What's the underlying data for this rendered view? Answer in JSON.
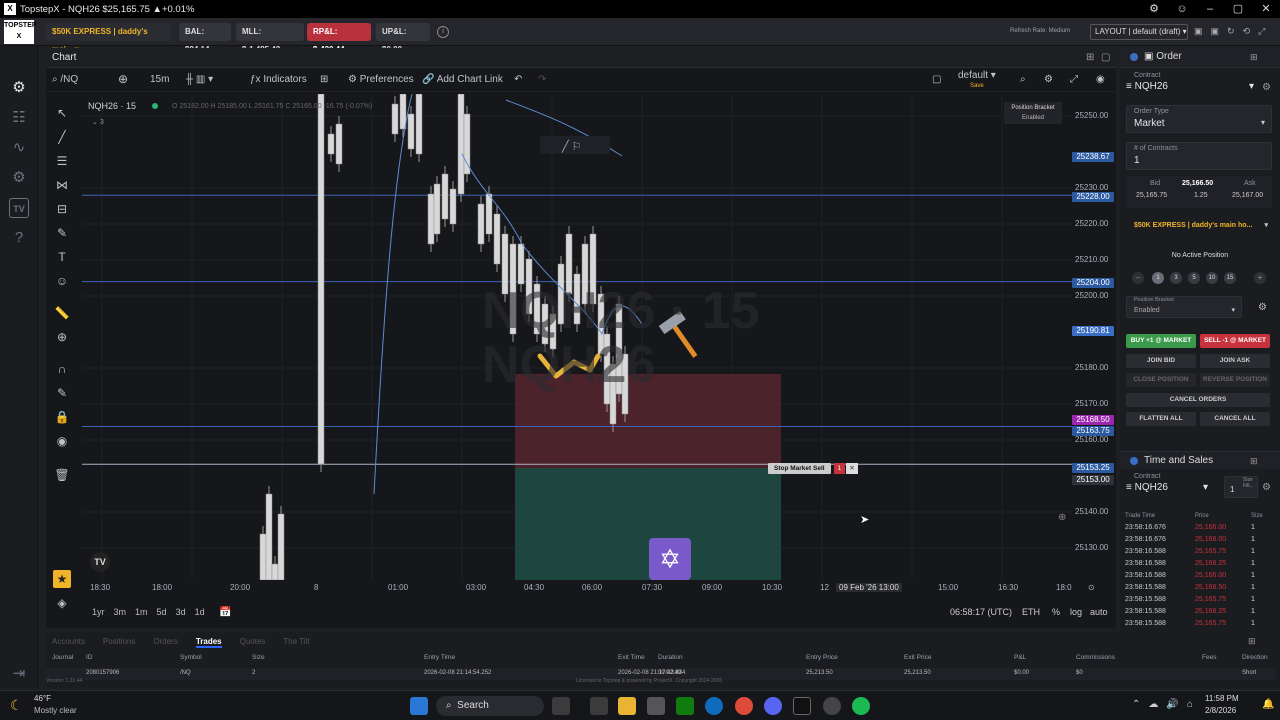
{
  "window": {
    "title": "TopstepX - NQH26 $25,165.75 ▲+0.01%"
  },
  "topbar": {
    "account": "$50K EXPRESS | daddy's mai...",
    "bal": "BAL: $94.14",
    "mll": "MLL: $-1,485.42",
    "rpl": "RP&L: $-420.44",
    "upl": "UP&L: $0.00",
    "refresh": "Refresh Rate: Medium",
    "layout": "LAYOUT | default (draft)"
  },
  "chart": {
    "panel_title": "Chart",
    "symbol": "/NQ",
    "interval": "15m",
    "indicators": "Indicators",
    "preferences": "Preferences",
    "add_link": "Add Chart Link",
    "layout_name": "default",
    "layout_sub": "Save",
    "legend_title": "NQH26 · 15",
    "legend_count": "3",
    "legend_ohlc": "O 25182.00  H 25185.00  L 25161.75  C 25165.00  -16.75 (-0.07%)",
    "bracket_title": "Position Bracket",
    "bracket_status": "Enabled",
    "watermark_1": "NQH26 · 15",
    "watermark_2": "NQH26",
    "stop_label": "Stop Market Sell",
    "stop_qty": "1",
    "tv_logo": "TV",
    "price_labels": [
      "25250.00",
      "25230.00",
      "25220.00",
      "25210.00",
      "25200.00",
      "25180.00",
      "25170.00",
      "25160.00",
      "25140.00",
      "25130.00"
    ],
    "tags": [
      {
        "text": "25238.67",
        "color": "#2c5aa0"
      },
      {
        "text": "25228.00",
        "color": "#2c5aa0"
      },
      {
        "text": "25204.00",
        "color": "#2c5aa0"
      },
      {
        "text": "25190.81",
        "color": "#3b6fc4"
      },
      {
        "text": "25168.50",
        "color": "#9c27b0"
      },
      {
        "text": "25163.75",
        "color": "#2c5aa0"
      },
      {
        "text": "25153.25",
        "color": "#2c5aa0"
      },
      {
        "text": "25153.00",
        "color": "#30323a"
      }
    ],
    "x_labels": [
      "18:30",
      "18:00",
      "20:00",
      "8",
      "01:00",
      "03:00",
      "04:30",
      "06:00",
      "07:30",
      "09:00",
      "10:30",
      "12",
      "09 Feb '26  13:00",
      "15:00",
      "16:30",
      "18:0"
    ],
    "ranges": [
      "1yr",
      "3m",
      "1m",
      "5d",
      "3d",
      "1d"
    ],
    "clock": "06:58:17 (UTC)",
    "session": "ETH",
    "pct": "%",
    "log": "log",
    "auto": "auto"
  },
  "order": {
    "title": "Order",
    "contract_label": "Contract",
    "contract": "NQH26",
    "type_label": "Order Type",
    "type": "Market",
    "qty_label": "# of Contracts",
    "qty": "1",
    "bid_label": "Bid",
    "bid": "25,165.75",
    "last": "25,166.50",
    "last_chg": "1.25",
    "ask_label": "Ask",
    "ask": "25,167.00",
    "account": "$50K EXPRESS | daddy's main ho...",
    "position": "No Active Position",
    "qty_buttons": [
      "1",
      "3",
      "5",
      "10",
      "15"
    ],
    "bracket_label": "Position Bracket",
    "bracket_value": "Enabled",
    "buy": "BUY +1 @ MARKET",
    "sell": "SELL -1 @ MARKET",
    "join_bid": "JOIN BID",
    "join_ask": "JOIN ASK",
    "close_pos": "CLOSE POSITION",
    "reverse_pos": "REVERSE POSITION",
    "cancel_orders": "CANCEL ORDERS",
    "flatten_all": "FLATTEN ALL",
    "cancel_all": "CANCEL ALL"
  },
  "tas": {
    "title": "Time and Sales",
    "contract_label": "Contract",
    "contract": "NQH26",
    "size_filter_label": "Size Filt...",
    "size_filter": "1",
    "headers": [
      "Trade Time",
      "Price",
      "Size"
    ],
    "rows": [
      {
        "time": "23:58:16.676",
        "price": "25,166.00",
        "size": "1"
      },
      {
        "time": "23:58:16.676",
        "price": "25,166.00",
        "size": "1"
      },
      {
        "time": "23:58:16.588",
        "price": "25,165.75",
        "size": "1"
      },
      {
        "time": "23:58:16.588",
        "price": "25,166.25",
        "size": "1"
      },
      {
        "time": "23:58:16.588",
        "price": "25,166.00",
        "size": "1"
      },
      {
        "time": "23:58:15.588",
        "price": "25,166.50",
        "size": "1"
      },
      {
        "time": "23:58:15.588",
        "price": "25,165.75",
        "size": "1"
      },
      {
        "time": "23:58:15.588",
        "price": "25,166.25",
        "size": "1"
      },
      {
        "time": "23:58:15.588",
        "price": "25,165.75",
        "size": "1"
      }
    ]
  },
  "bottom": {
    "tabs": [
      "Accounts",
      "Positions",
      "Orders",
      "Trades",
      "Quotes",
      "The Tilt"
    ],
    "active_tab": "Trades",
    "headers": [
      "Journal",
      "ID",
      "Symbol",
      "Size",
      "Entry Time",
      "Exit Time",
      "Duration",
      "Entry Price",
      "Exit Price",
      "P&L",
      "Commissions",
      "Fees",
      "Direction"
    ],
    "row": [
      "",
      "2080157906",
      "/NQ",
      "2",
      "2026-02-08 21:14:54.252",
      "2026-02-08 21:17:43.834",
      "00:02:49",
      "25,213.50",
      "25,213.50",
      "$0.00",
      "$0",
      "",
      "Short"
    ],
    "version": "Version: 1.21.44",
    "license": "Licensed to Topstep & powered by ProjectX. Copyright 2024-2026"
  },
  "taskbar": {
    "weather_temp": "46°F",
    "weather_desc": "Mostly clear",
    "search": "Search",
    "time": "11:58 PM",
    "date": "2/8/2026"
  },
  "colors": {
    "accent": "#2962ff",
    "buy": "#3a9a4a",
    "sell": "#c8323c",
    "profit_zone": "#1e4f45",
    "loss_zone": "#5a2530"
  }
}
